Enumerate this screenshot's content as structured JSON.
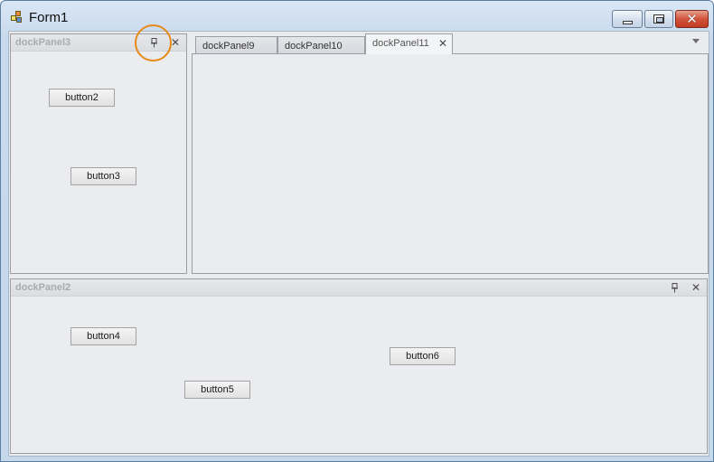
{
  "window": {
    "title": "Form1",
    "controls": {
      "minimize": "minimize",
      "maximize": "maximize",
      "close": "✕"
    }
  },
  "dockPanel3": {
    "title": "dockPanel3",
    "buttons": [
      "button2",
      "button3"
    ],
    "close_glyph": "✕"
  },
  "tabs": [
    {
      "label": "dockPanel9",
      "active": false
    },
    {
      "label": "dockPanel10",
      "active": false
    },
    {
      "label": "dockPanel11",
      "active": true
    }
  ],
  "tab_close_glyph": "✕",
  "dockPanel2": {
    "title": "dockPanel2",
    "buttons": [
      "button4",
      "button5",
      "button6"
    ],
    "close_glyph": "✕"
  },
  "annotation": {
    "color": "#e68a18",
    "target": "dockPanel3-pin"
  },
  "colors": {
    "panel_bg": "#ebecef",
    "panel_border": "#9b9ea3",
    "title_inactive": "#a8abb0"
  }
}
